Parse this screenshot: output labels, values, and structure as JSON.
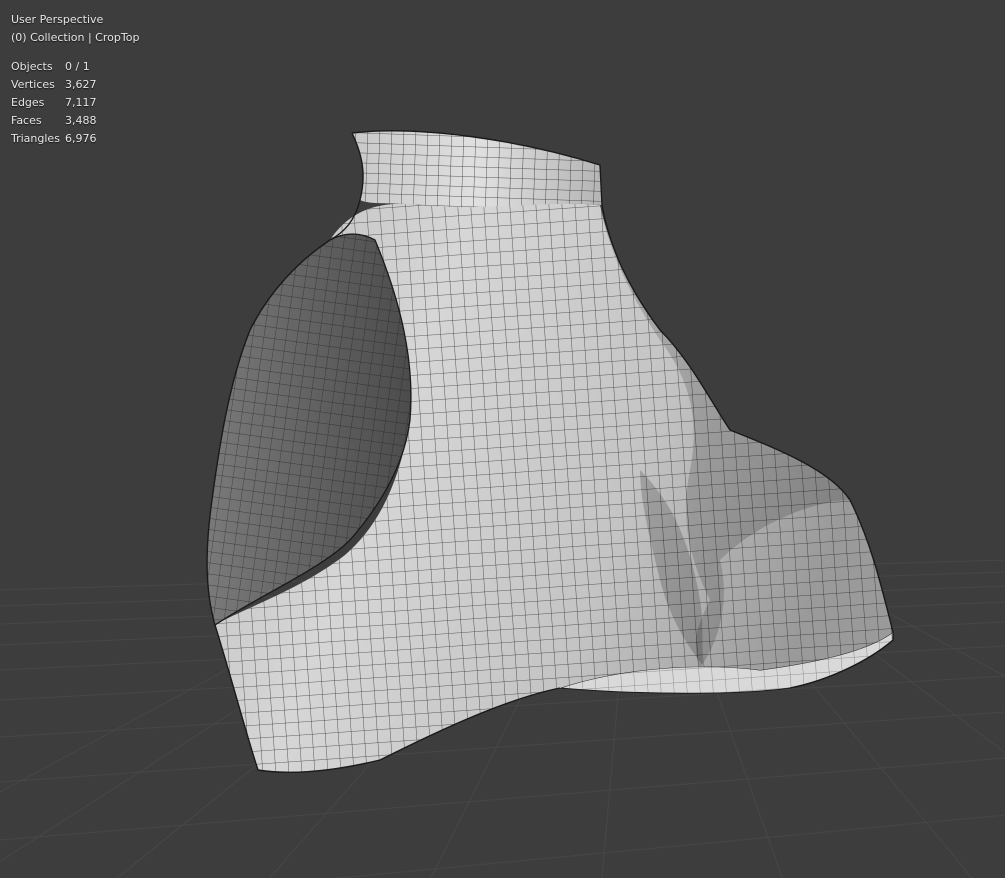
{
  "viewport": {
    "view_name": "User Perspective",
    "collection_info": "(0) Collection | CropTop"
  },
  "stats": [
    {
      "label": "Objects",
      "value": "0 / 1"
    },
    {
      "label": "Vertices",
      "value": "3,627"
    },
    {
      "label": "Edges",
      "value": "7,117"
    },
    {
      "label": "Faces",
      "value": "3,488"
    },
    {
      "label": "Triangles",
      "value": "6,976"
    }
  ],
  "colors": {
    "background": "#3d3d3d",
    "grid": "#4a4a4a",
    "mesh_light": "#cfcfcf",
    "mesh_dark": "#6a6a6a",
    "wire": "#1c1c1c"
  }
}
